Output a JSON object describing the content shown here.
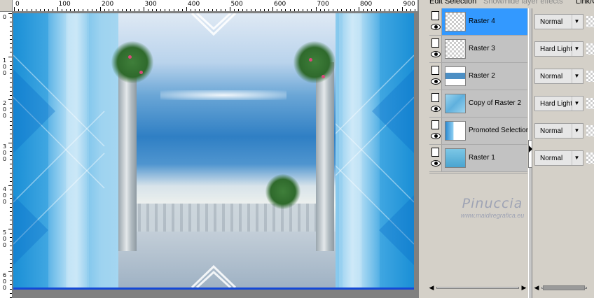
{
  "palette": {
    "tabs": {
      "active": "Edit Selection",
      "inactive": "Show/hide layer effects",
      "link": "Link/O"
    },
    "layers": [
      {
        "name": "Raster 4",
        "blend": "Normal",
        "selected": true,
        "thumb": "transparent"
      },
      {
        "name": "Raster 3",
        "blend": "Hard Light",
        "selected": false,
        "thumb": "transparent"
      },
      {
        "name": "Raster 2",
        "blend": "Normal",
        "selected": false,
        "thumb": "image"
      },
      {
        "name": "Copy of Raster 2",
        "blend": "Hard Light",
        "selected": false,
        "thumb": "chevrons"
      },
      {
        "name": "Promoted Selection",
        "blend": "Normal",
        "selected": false,
        "thumb": "promoted"
      },
      {
        "name": "Raster 1",
        "blend": "Normal",
        "selected": false,
        "thumb": "blue-fill"
      }
    ]
  },
  "watermark": {
    "name": "Pinuccia",
    "url": "www.maidiregrafica.eu"
  },
  "ruler": {
    "horizontal_labels": [
      "0",
      "100",
      "200",
      "300",
      "400",
      "500",
      "600",
      "700",
      "800",
      "900"
    ],
    "vertical_labels": [
      "0",
      "100",
      "200",
      "300",
      "400",
      "500",
      "600"
    ]
  },
  "icons": {
    "visibility": "eye-icon",
    "layer_type": "page-icon",
    "dropdown": "chevron-down-icon",
    "scroll_left": "arrow-left-icon",
    "scroll_right": "arrow-right-icon",
    "expand": "arrow-right-icon"
  },
  "colors": {
    "selection": "#3399ff",
    "row_bg": "#c2c2c2",
    "panel_bg": "#d4d0c8",
    "watermark": "#9ea3b4"
  }
}
